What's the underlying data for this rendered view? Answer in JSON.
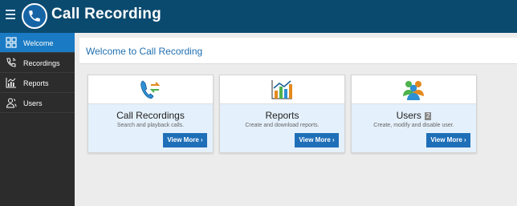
{
  "header": {
    "title": "Call Recording"
  },
  "sidebar": {
    "items": [
      {
        "label": "Welcome",
        "icon": "grid-icon",
        "active": true
      },
      {
        "label": "Recordings",
        "icon": "phone-wave-icon",
        "active": false
      },
      {
        "label": "Reports",
        "icon": "chart-icon",
        "active": false
      },
      {
        "label": "Users",
        "icon": "users-icon",
        "active": false
      }
    ]
  },
  "main": {
    "title": "Welcome to Call Recording",
    "cards": [
      {
        "title": "Call Recordings",
        "description": "Search and playback calls.",
        "button": "View More ›",
        "icon": "phone-arrows-icon"
      },
      {
        "title": "Reports",
        "description": "Create and download reports.",
        "button": "View More ›",
        "icon": "bar-chart-icon"
      },
      {
        "title": "Users",
        "badge": "2",
        "description": "Create, modify and disable user.",
        "button": "View More ›",
        "icon": "user-group-icon"
      }
    ]
  },
  "colors": {
    "topbar": "#0b4a6f",
    "accent": "#1a7bc4",
    "sidebar": "#2c2c2c",
    "card": "#e4f0fb"
  }
}
